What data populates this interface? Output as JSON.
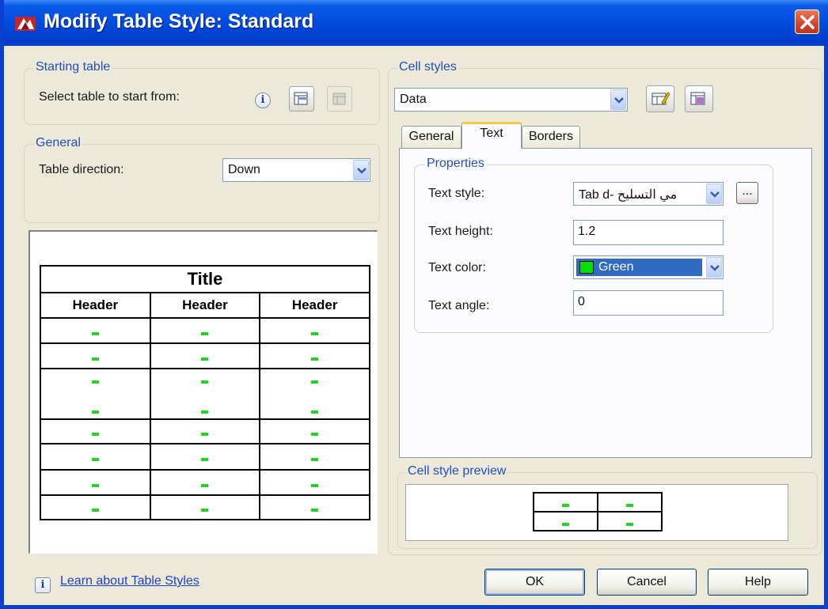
{
  "window": {
    "title": "Modify Table Style: Standard"
  },
  "starting_table": {
    "legend": "Starting table",
    "select_label": "Select table to start from:"
  },
  "general": {
    "legend": "General",
    "direction_label": "Table direction:",
    "direction_value": "Down"
  },
  "preview_table": {
    "title": "Title",
    "headers": [
      "Header",
      "Header",
      "Header"
    ]
  },
  "cell_styles": {
    "legend": "Cell styles",
    "current": "Data",
    "tabs": [
      "General",
      "Text",
      "Borders"
    ],
    "active_tab": "Text"
  },
  "properties": {
    "legend": "Properties",
    "text_style_label": "Text style:",
    "text_style_value": "Tab d- مي التسليح",
    "text_height_label": "Text height:",
    "text_height_value": "1.2",
    "text_color_label": "Text color:",
    "text_color_value": "Green",
    "text_color_swatch": "#00e000",
    "text_angle_label": "Text angle:",
    "text_angle_value": "0",
    "browse_label": "..."
  },
  "cell_style_preview": {
    "legend": "Cell style preview"
  },
  "footer": {
    "info_icon": "i",
    "learn_link": "Learn about Table Styles",
    "ok": "OK",
    "cancel": "Cancel",
    "help": "Help"
  },
  "colors": {
    "title_bar": "#0049dc",
    "legend_text": "#1f4fbf",
    "selection": "#316ac5",
    "data_mark": "#22d422"
  }
}
